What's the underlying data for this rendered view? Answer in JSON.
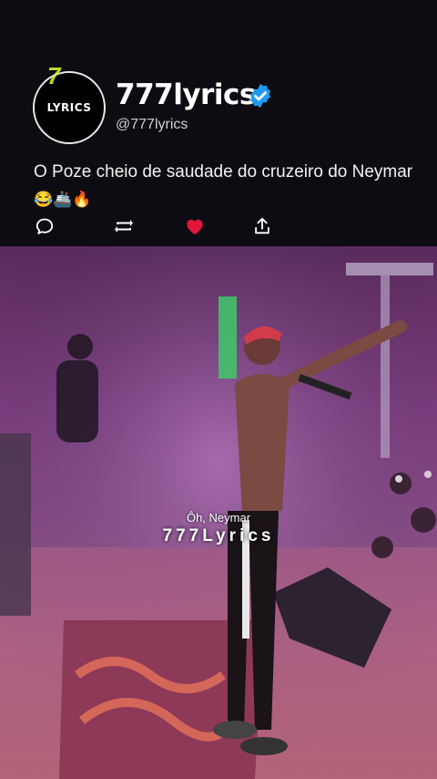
{
  "profile": {
    "avatar_text": "LYRICS",
    "display_name": "777lyrics",
    "handle": "@777lyrics"
  },
  "post": {
    "text": "O Poze cheio de saudade do cruzeiro do Neymar",
    "emojis": "😂🚢🔥"
  },
  "actions": {
    "reply": "chat-bubble-icon",
    "repost": "repost-icon",
    "like": "heart-icon",
    "share": "share-icon",
    "like_color": "#e0163a"
  },
  "media": {
    "subtitle": "Ôh, Neymar",
    "watermark": "777Lyrics"
  },
  "colors": {
    "background": "#0d0c12",
    "verified": "#1d9bf0"
  }
}
